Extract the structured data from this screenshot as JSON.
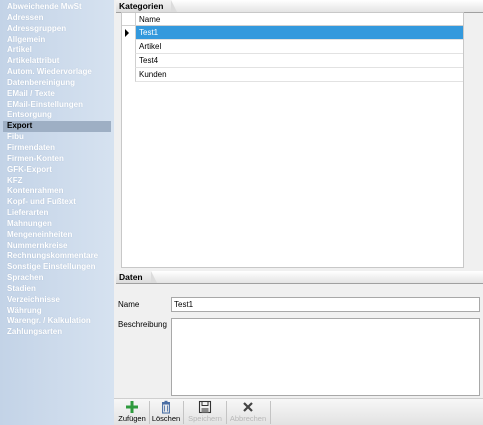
{
  "sidebar": {
    "items": [
      {
        "label": "Abweichende MwSt"
      },
      {
        "label": "Adressen"
      },
      {
        "label": "Adressgruppen"
      },
      {
        "label": "Allgemein"
      },
      {
        "label": "Artikel"
      },
      {
        "label": "Artikelattribut"
      },
      {
        "label": "Autom. Wiedervorlage"
      },
      {
        "label": "Datenbereinigung"
      },
      {
        "label": "EMail / Texte"
      },
      {
        "label": "EMail-Einstellungen"
      },
      {
        "label": "Entsorgung"
      },
      {
        "label": "Export",
        "active": true
      },
      {
        "label": "Fibu"
      },
      {
        "label": "Firmendaten"
      },
      {
        "label": "Firmen-Konten"
      },
      {
        "label": "GFK-Export"
      },
      {
        "label": "KFZ"
      },
      {
        "label": "Kontenrahmen"
      },
      {
        "label": "Kopf- und Fußtext"
      },
      {
        "label": "Lieferarten"
      },
      {
        "label": "Mahnungen"
      },
      {
        "label": "Mengeneinheiten"
      },
      {
        "label": "Nummernkreise"
      },
      {
        "label": "Rechnungskommentare"
      },
      {
        "label": "Sonstige Einstellungen"
      },
      {
        "label": "Sprachen"
      },
      {
        "label": "Stadien"
      },
      {
        "label": "Verzeichnisse"
      },
      {
        "label": "Währung"
      },
      {
        "label": "Warengr. / Kalkulation"
      },
      {
        "label": "Zahlungsarten"
      }
    ]
  },
  "kategorien": {
    "title": "Kategorien",
    "column_header": "Name",
    "rows": [
      "Test1",
      "Artikel",
      "Test4",
      "Kunden"
    ],
    "selected_index": 0
  },
  "daten": {
    "title": "Daten",
    "name_label": "Name",
    "name_value": "Test1",
    "description_label": "Beschreibung",
    "description_value": ""
  },
  "toolbar": {
    "add_label": "Zufügen",
    "delete_label": "Löschen",
    "save_label": "Speichern",
    "cancel_label": "Abbrechen"
  },
  "colors": {
    "selection": "#3399dd",
    "add_icon": "#2e9a3e",
    "delete_icon": "#4a6fa5"
  },
  "icons": {
    "add": "plus-icon",
    "delete": "trash-icon",
    "save": "floppy-disk-icon",
    "cancel": "cross-icon",
    "row_indicator": "triangle-right-icon"
  }
}
